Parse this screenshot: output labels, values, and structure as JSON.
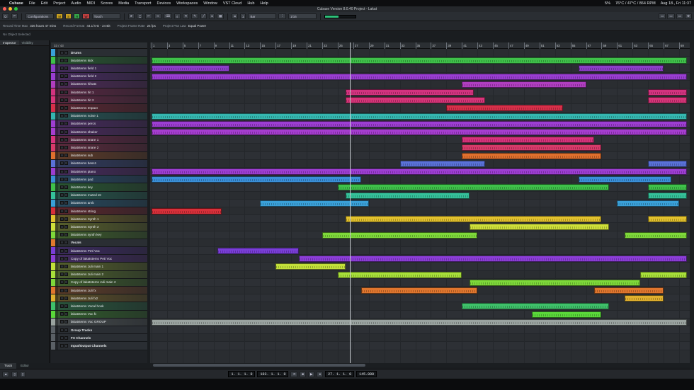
{
  "menubar": {
    "items": [
      "Cubase",
      "File",
      "Edit",
      "Project",
      "Audio",
      "MIDI",
      "Scores",
      "Media",
      "Transport",
      "Devices",
      "Workspaces",
      "Window",
      "VST Cloud",
      "Hub",
      "Help"
    ],
    "right": [
      "5%",
      "76°C / 47°C / 864 RPM",
      "Aug 18., Fri 11:37"
    ]
  },
  "window": {
    "title": "Cubase Version 8.0.40 Project - Lakat"
  },
  "toolbar": {
    "configurations": "Configurations",
    "automation_mode": "Touch",
    "quantize": "1/16",
    "grid": "Bar",
    "nudge": "1"
  },
  "info": {
    "record_time_max_label": "Record Time Max",
    "record_time_max": "336 hours 47 mins",
    "record_format_label": "Record Format",
    "record_format": "44.1 kHz - 24 Bit",
    "frame_rate_label": "Project Frame Rate",
    "frame_rate": "24 fps",
    "pan_law_label": "Project Pan Law",
    "pan_law": "Equal Power"
  },
  "status": {
    "no_object": "No Object Selected"
  },
  "left_tabs": {
    "inspector": "Inspector",
    "visibility": "Visibility"
  },
  "bottom_tabs": {
    "track": "Track",
    "editor": "Editor"
  },
  "tracklist_header": "33 / 43",
  "ruler": [
    "1",
    "3",
    "5",
    "7",
    "9",
    "11",
    "13",
    "15",
    "17",
    "19",
    "21",
    "23",
    "25",
    "27",
    "29",
    "31",
    "33",
    "35",
    "37",
    "39",
    "41",
    "43",
    "45",
    "47",
    "49",
    "51",
    "53",
    "55",
    "57",
    "59",
    "61",
    "63",
    "65",
    "67",
    "69"
  ],
  "tracks": [
    {
      "name": "Drums",
      "color": "#3aa0d8",
      "folder": true
    },
    {
      "name": "lakatstems kick",
      "color": "#3fc14a"
    },
    {
      "name": "lakatstems field 1",
      "color": "#8c3ec8"
    },
    {
      "name": "lakatstems field 2",
      "color": "#9a3ed2"
    },
    {
      "name": "lakatstems hihats",
      "color": "#b03ec0"
    },
    {
      "name": "lakatstems hit 1",
      "color": "#d2337f"
    },
    {
      "name": "lakatstems hit 2",
      "color": "#d8357a"
    },
    {
      "name": "lakatstems Impact",
      "color": "#d8304a"
    },
    {
      "name": "lakatstems noise 1",
      "color": "#35b7b0"
    },
    {
      "name": "lakatstems percs",
      "color": "#9d3ed2"
    },
    {
      "name": "lakatstems shaker",
      "color": "#a63ed0"
    },
    {
      "name": "lakatstems snare 1",
      "color": "#d8337c"
    },
    {
      "name": "lakatstems snare 2",
      "color": "#d83a6a"
    },
    {
      "name": "lakatstems sub",
      "color": "#e0702e"
    },
    {
      "name": "lakatstems bass1",
      "color": "#5a72d8"
    },
    {
      "name": "lakatstems piano",
      "color": "#9d3ed2"
    },
    {
      "name": "lakatstems pad",
      "color": "#3a8fd8"
    },
    {
      "name": "lakatstems key",
      "color": "#3fc14a"
    },
    {
      "name": "lakatstems muted str",
      "color": "#35c19a"
    },
    {
      "name": "lakatstems amb",
      "color": "#3aa0d8"
    },
    {
      "name": "lakatstems string",
      "color": "#d8303a"
    },
    {
      "name": "lakatstems Synth 1",
      "color": "#e3c22e"
    },
    {
      "name": "lakatstems Synth 2",
      "color": "#cfe03a"
    },
    {
      "name": "lakatstems synth key",
      "color": "#7ed83a"
    },
    {
      "name": "Vocals",
      "color": "#e07a2e",
      "folder": true
    },
    {
      "name": "lakatstems Peti Voc",
      "color": "#7a3ed8"
    },
    {
      "name": "Copy of lakatstems Peti Voc",
      "color": "#8c3ed8"
    },
    {
      "name": "lakatstems Juli main 1",
      "color": "#c3e03a"
    },
    {
      "name": "lakatstems Juli main 2",
      "color": "#a8e03a"
    },
    {
      "name": "Copy of lakatstems Juli main 2",
      "color": "#7ed83a"
    },
    {
      "name": "lakatstems Juli fx",
      "color": "#e0762e"
    },
    {
      "name": "lakatstems Juli fx2",
      "color": "#e0b02e"
    },
    {
      "name": "lakatstems Vocal hook",
      "color": "#3fc16a"
    },
    {
      "name": "lakatstems Voc fx",
      "color": "#5ad83a"
    },
    {
      "name": "lakatstems Voc GROUP",
      "color": "#9aa3a0"
    },
    {
      "name": "Group Tracks",
      "color": "#5a6066",
      "folder": true
    },
    {
      "name": "FX Channels",
      "color": "#5a6066",
      "folder": true
    },
    {
      "name": "Input/Output Channels",
      "color": "#5a6066",
      "folder": true
    }
  ],
  "parts": [
    {
      "t": 1,
      "s": 1,
      "e": 70,
      "c": "#3fc14a"
    },
    {
      "t": 2,
      "s": 1,
      "e": 11,
      "c": "#8c3ec8"
    },
    {
      "t": 2,
      "s": 56,
      "e": 67,
      "c": "#8c3ec8"
    },
    {
      "t": 3,
      "s": 1,
      "e": 70,
      "c": "#9a3ed2"
    },
    {
      "t": 4,
      "s": 41,
      "e": 57,
      "c": "#b03ec0"
    },
    {
      "t": 5,
      "s": 26,
      "e": 42.5,
      "c": "#d2337f"
    },
    {
      "t": 5,
      "s": 65,
      "e": 70,
      "c": "#d2337f"
    },
    {
      "t": 6,
      "s": 26,
      "e": 44,
      "c": "#d8357a"
    },
    {
      "t": 6,
      "s": 65,
      "e": 70,
      "c": "#d8357a"
    },
    {
      "t": 7,
      "s": 39,
      "e": 54,
      "c": "#d8304a"
    },
    {
      "t": 8,
      "s": 1,
      "e": 70,
      "c": "#35b7b0"
    },
    {
      "t": 9,
      "s": 1,
      "e": 70,
      "c": "#9d3ed2"
    },
    {
      "t": 10,
      "s": 1,
      "e": 70,
      "c": "#a63ed0"
    },
    {
      "t": 11,
      "s": 41,
      "e": 58,
      "c": "#d8337c"
    },
    {
      "t": 12,
      "s": 41,
      "e": 59,
      "c": "#d83a6a"
    },
    {
      "t": 13,
      "s": 41,
      "e": 59,
      "c": "#e0702e"
    },
    {
      "t": 14,
      "s": 33,
      "e": 44,
      "c": "#5a72d8"
    },
    {
      "t": 14,
      "s": 65,
      "e": 70,
      "c": "#5a72d8"
    },
    {
      "t": 15,
      "s": 1,
      "e": 70,
      "c": "#9d3ed2"
    },
    {
      "t": 16,
      "s": 1,
      "e": 28,
      "c": "#3a8fd8"
    },
    {
      "t": 16,
      "s": 56,
      "e": 68,
      "c": "#3a8fd8"
    },
    {
      "t": 17,
      "s": 25,
      "e": 60,
      "c": "#3fc14a"
    },
    {
      "t": 17,
      "s": 65,
      "e": 70,
      "c": "#3fc14a"
    },
    {
      "t": 18,
      "s": 26,
      "e": 42,
      "c": "#35c19a"
    },
    {
      "t": 18,
      "s": 65,
      "e": 70,
      "c": "#35c19a"
    },
    {
      "t": 19,
      "s": 15,
      "e": 29,
      "c": "#3aa0d8"
    },
    {
      "t": 19,
      "s": 61,
      "e": 69,
      "c": "#3aa0d8"
    },
    {
      "t": 20,
      "s": 1,
      "e": 10,
      "c": "#d8303a"
    },
    {
      "t": 21,
      "s": 26,
      "e": 59,
      "c": "#e3c22e"
    },
    {
      "t": 21,
      "s": 65,
      "e": 70,
      "c": "#e3c22e"
    },
    {
      "t": 22,
      "s": 42,
      "e": 60,
      "c": "#cfe03a"
    },
    {
      "t": 23,
      "s": 23,
      "e": 43,
      "c": "#7ed83a"
    },
    {
      "t": 23,
      "s": 62,
      "e": 70,
      "c": "#7ed83a"
    },
    {
      "t": 25,
      "s": 9.5,
      "e": 20,
      "c": "#7a3ed8"
    },
    {
      "t": 26,
      "s": 20,
      "e": 70,
      "c": "#8c3ed8"
    },
    {
      "t": 27,
      "s": 17,
      "e": 26,
      "c": "#c3e03a"
    },
    {
      "t": 28,
      "s": 25,
      "e": 41,
      "c": "#a8e03a"
    },
    {
      "t": 28,
      "s": 64,
      "e": 70,
      "c": "#a8e03a"
    },
    {
      "t": 29,
      "s": 42,
      "e": 64,
      "c": "#7ed83a"
    },
    {
      "t": 30,
      "s": 28,
      "e": 43,
      "c": "#e0762e"
    },
    {
      "t": 30,
      "s": 58,
      "e": 67,
      "c": "#e0762e"
    },
    {
      "t": 31,
      "s": 62,
      "e": 67,
      "c": "#e0b02e"
    },
    {
      "t": 32,
      "s": 41,
      "e": 60,
      "c": "#3fc16a"
    },
    {
      "t": 33,
      "s": 50,
      "e": 59,
      "c": "#5ad83a"
    },
    {
      "t": 34,
      "s": 1,
      "e": 70,
      "c": "#9aa3a0"
    }
  ],
  "transport": {
    "left_locator": "1. 1. 1. 0",
    "right_locator": "103. 1. 1. 0",
    "position": "27. 1. 1. 0",
    "tempo": "145.000"
  }
}
